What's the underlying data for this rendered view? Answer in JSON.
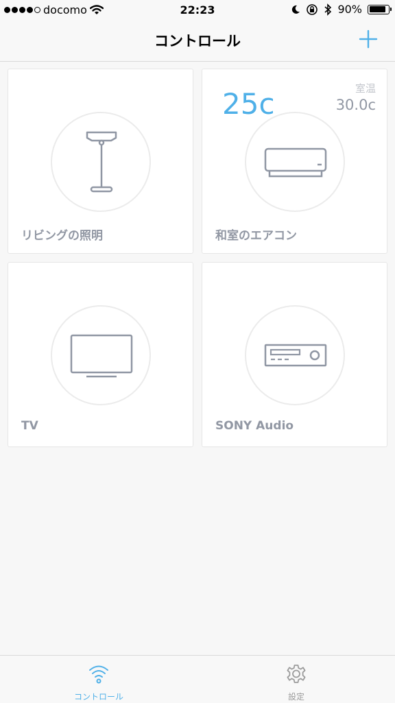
{
  "status_bar": {
    "carrier": "docomo",
    "time": "22:23",
    "battery": "90%",
    "battery_level": 0.9
  },
  "nav": {
    "title": "コントロール",
    "add_icon": "plus-icon",
    "accent_color": "#4fb0e8"
  },
  "devices": [
    {
      "label": "リビングの照明",
      "icon": "floor-lamp-icon"
    },
    {
      "label": "和室のエアコン",
      "icon": "air-conditioner-icon",
      "set_temp": "25c",
      "room_label": "室温",
      "room_temp": "30.0c"
    },
    {
      "label": "TV",
      "icon": "tv-icon"
    },
    {
      "label": "SONY Audio",
      "icon": "audio-receiver-icon"
    }
  ],
  "tabs": [
    {
      "label": "コントロール",
      "icon": "wifi-icon",
      "active": true,
      "color": "#4fb0e8"
    },
    {
      "label": "設定",
      "icon": "gear-icon",
      "active": false,
      "color": "#9b9b9b"
    }
  ]
}
